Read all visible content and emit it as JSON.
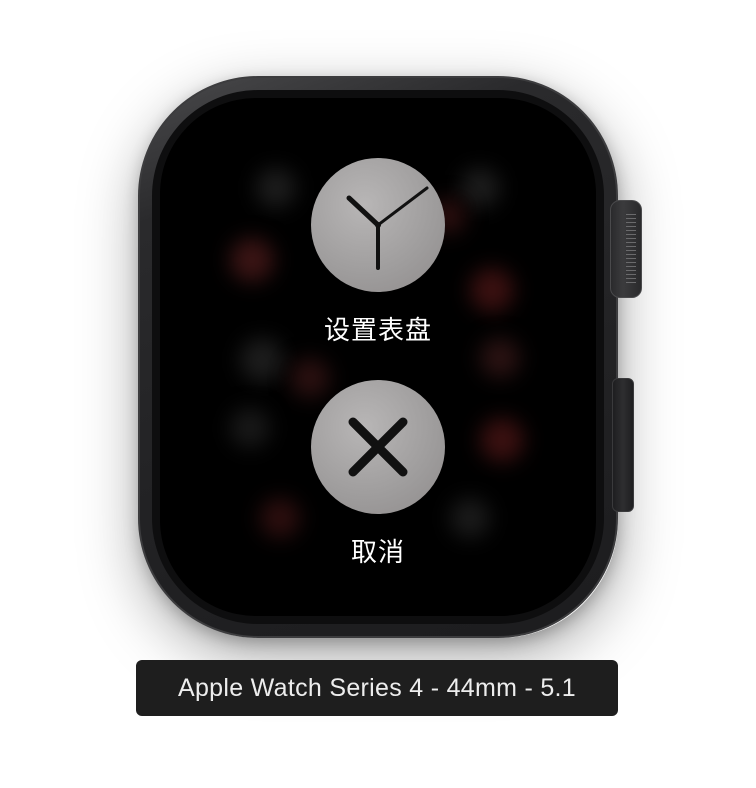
{
  "device": {
    "label": "Apple Watch Series 4 - 44mm - 5.1"
  },
  "actions": {
    "set_face": {
      "label": "设置表盘",
      "icon": "clock-face-icon"
    },
    "cancel": {
      "label": "取消",
      "icon": "close-icon"
    }
  },
  "colors": {
    "button_fill": "#9e9c9c",
    "screen": "#000000",
    "label_background": "#1e1e1e"
  }
}
